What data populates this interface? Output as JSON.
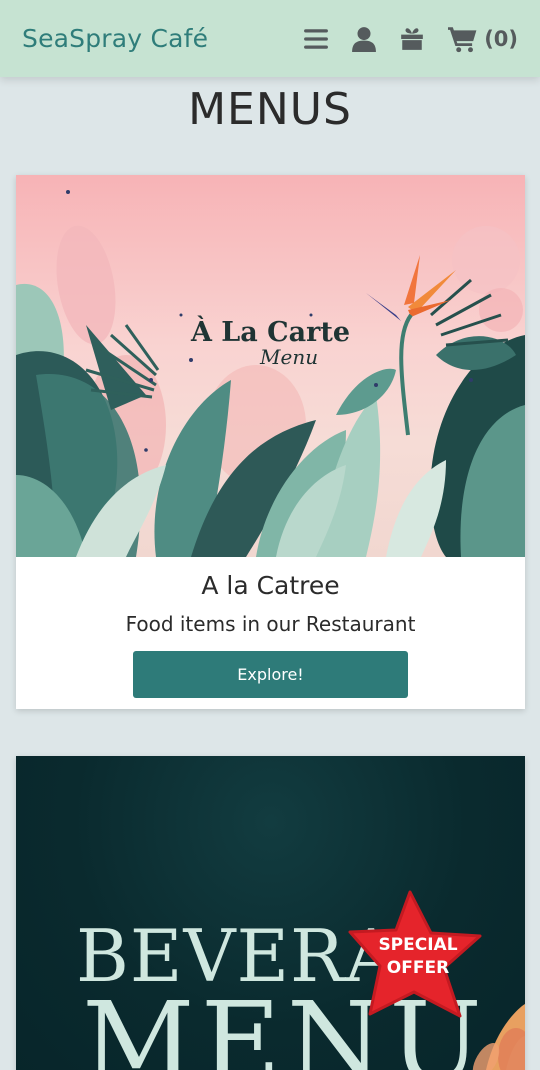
{
  "header": {
    "brand": "SeaSpray Café",
    "icons": [
      "menu-icon",
      "user-icon",
      "gift-icon",
      "cart-icon"
    ],
    "cart_count": "(0)"
  },
  "page": {
    "title": "MENUS"
  },
  "cards": [
    {
      "image_title": "À La Carte",
      "image_subtitle": "Menu",
      "title": "A la Catree",
      "text": "Food items in our Restaurant",
      "button": "Explore!"
    },
    {
      "image_word": "BEVERA",
      "image_word_2": "MENU",
      "badge_line1": "SPECIAL",
      "badge_line2": "OFFER"
    }
  ],
  "colors": {
    "header_bg": "#c6e3d2",
    "brand": "#2f7d7a",
    "button": "#2e7b79",
    "page_bg": "#dde6e8"
  }
}
